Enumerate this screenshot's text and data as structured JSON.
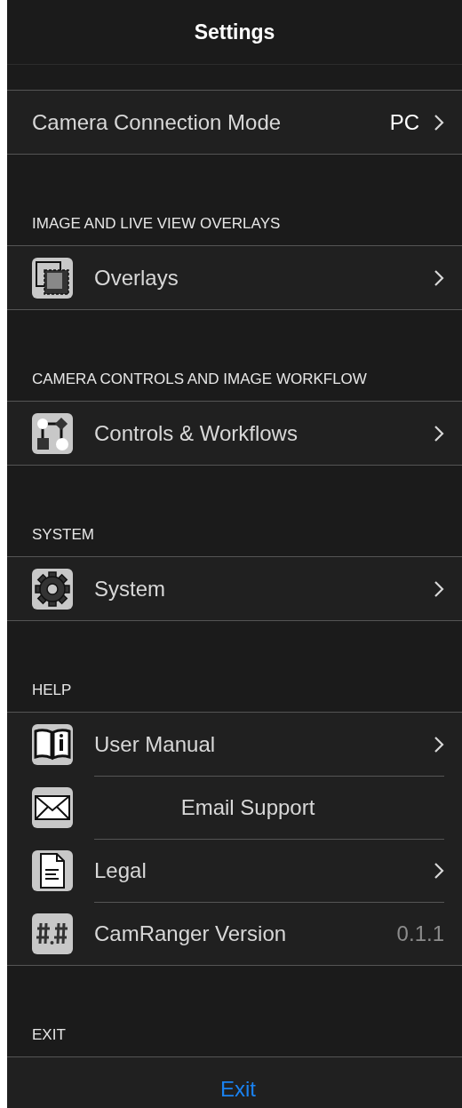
{
  "title": "Settings",
  "sections": [
    {
      "rows": [
        {
          "kind": "detail",
          "label": "Camera Connection Mode",
          "value": "PC",
          "chevron": true
        }
      ]
    },
    {
      "header": "IMAGE AND LIVE VIEW OVERLAYS",
      "rows": [
        {
          "kind": "detail",
          "label": "Overlays",
          "chevron": true
        }
      ]
    },
    {
      "header": "CAMERA CONTROLS AND IMAGE WORKFLOW",
      "rows": [
        {
          "kind": "detail",
          "label": "Controls & Workflows",
          "chevron": true
        }
      ]
    },
    {
      "header": "SYSTEM",
      "rows": [
        {
          "kind": "detail",
          "label": "System",
          "chevron": true
        }
      ]
    },
    {
      "header": "HELP",
      "rows": [
        {
          "kind": "detail",
          "label": "User Manual",
          "chevron": true
        },
        {
          "kind": "centered",
          "label": "Email Support",
          "chevron": false
        },
        {
          "kind": "detail",
          "label": "Legal",
          "chevron": true
        },
        {
          "kind": "detail",
          "label": "CamRanger Version",
          "value": "0.1.1",
          "chevron": false
        }
      ]
    },
    {
      "header": "EXIT",
      "rows": [
        {
          "kind": "button",
          "label": "Exit",
          "chevron": false
        }
      ]
    }
  ]
}
